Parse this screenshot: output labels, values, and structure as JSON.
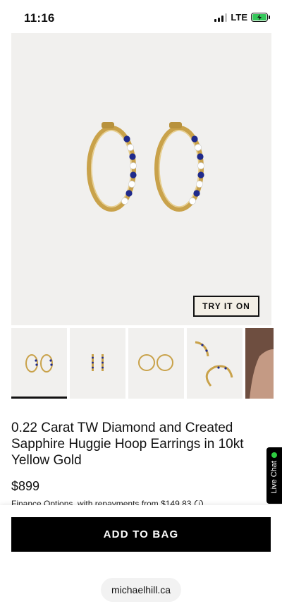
{
  "status_bar": {
    "time": "11:16",
    "network": "LTE",
    "battery_color": "#34c759"
  },
  "product": {
    "try_on_label": "TRY IT ON",
    "title": "0.22 Carat TW Diamond and Created Sapphire Huggie Hoop Earrings in 10kt Yellow Gold",
    "price": "$899",
    "finance_text": "Finance Options, with repayments from $149.83"
  },
  "thumbnails": [
    {
      "name": "thumb-front-view",
      "active": true
    },
    {
      "name": "thumb-side-view",
      "active": false
    },
    {
      "name": "thumb-back-view",
      "active": false
    },
    {
      "name": "thumb-open-view",
      "active": false
    },
    {
      "name": "thumb-model-photo",
      "active": false
    }
  ],
  "actions": {
    "add_to_bag": "ADD TO BAG"
  },
  "browser": {
    "url": "michaelhill.ca"
  },
  "live_chat": {
    "label": "Live Chat",
    "status_color": "#2ecc40"
  },
  "colors": {
    "gold": "#c9a24a",
    "sapphire": "#1f2a8c",
    "image_background": "#f1f0ee"
  }
}
